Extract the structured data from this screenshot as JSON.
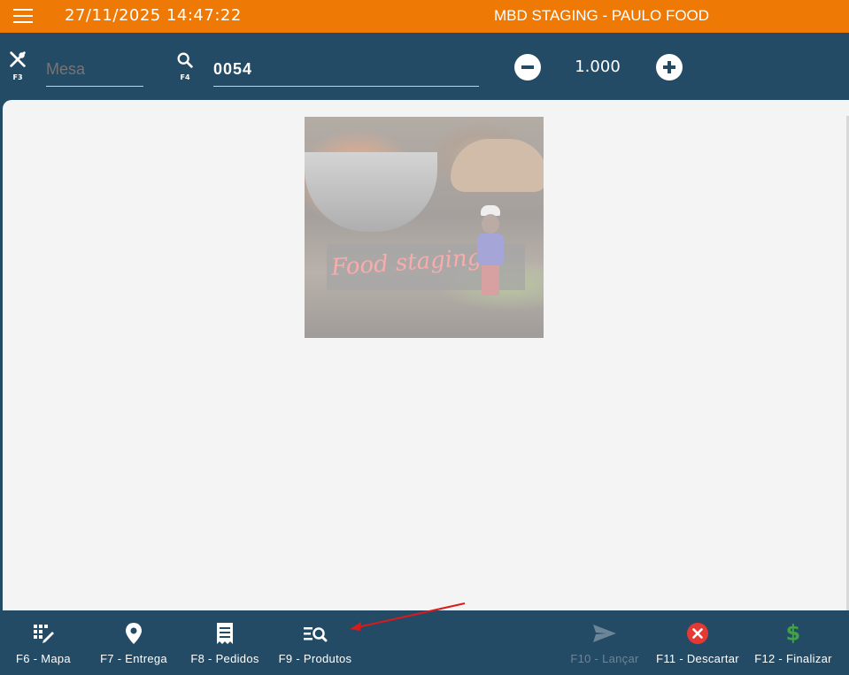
{
  "topbar": {
    "menu_icon": "hamburger-menu-icon",
    "datetime": "27/11/2025 14:47:22",
    "app_title": "MBD STAGING - PAULO FOOD"
  },
  "inputbar": {
    "mesa": {
      "icon": "cutlery-icon",
      "key": "F3",
      "placeholder": "Mesa",
      "value": ""
    },
    "code": {
      "icon": "search-icon",
      "key": "F4",
      "value": "0054"
    },
    "quantity": {
      "value": "1.000",
      "decrement_icon": "minus-circle-icon",
      "increment_icon": "plus-circle-icon"
    }
  },
  "content": {
    "logo_text": "Food staging"
  },
  "bottom_nav": [
    {
      "label": "F6 - Mapa",
      "icon": "table-map-icon",
      "enabled": true
    },
    {
      "label": "F7 - Entrega",
      "icon": "location-pin-icon",
      "enabled": true
    },
    {
      "label": "F8 - Pedidos",
      "icon": "receipt-icon",
      "enabled": true
    },
    {
      "label": "F9 - Produtos",
      "icon": "product-search-icon",
      "enabled": true
    },
    {
      "label": "F10 - Lançar",
      "icon": "send-icon",
      "enabled": false
    },
    {
      "label": "F11 - Descartar",
      "icon": "cancel-circle-icon",
      "enabled": true,
      "color": "#e53935"
    },
    {
      "label": "F12 - Finalizar",
      "icon": "dollar-icon",
      "enabled": true,
      "color": "#43a047"
    }
  ],
  "colors": {
    "topbar": "#ee7a05",
    "navy": "#234b66",
    "annotation_arrow": "#d81b1b"
  }
}
